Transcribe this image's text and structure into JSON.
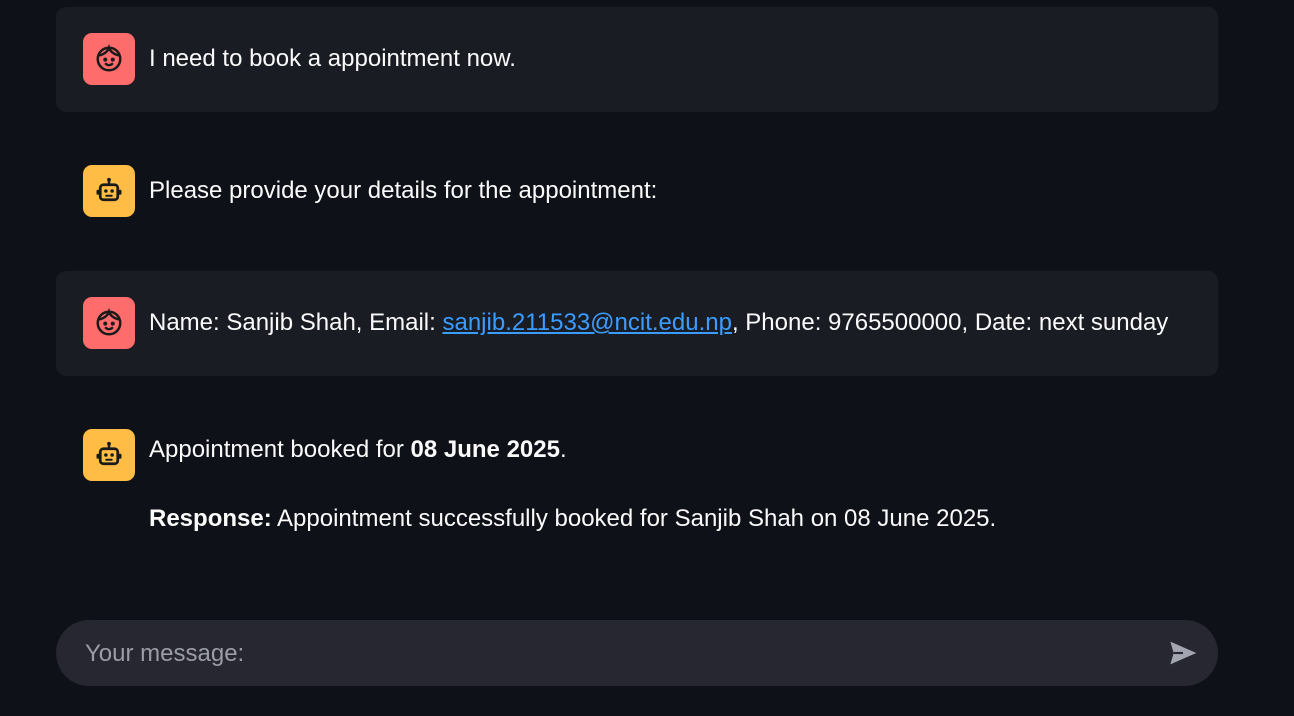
{
  "messages": [
    {
      "role": "user",
      "text": "I need to book a appointment now."
    },
    {
      "role": "assistant",
      "text": "Please provide your details for the appointment:"
    },
    {
      "role": "user",
      "name_prefix": "Name: Sanjib Shah, Email: ",
      "email": "sanjib.211533@ncit.edu.np",
      "suffix": ", Phone: 9765500000, Date: next sunday"
    },
    {
      "role": "assistant",
      "line1_prefix": "Appointment booked for ",
      "line1_bold": "08 June 2025",
      "line1_suffix": ".",
      "line2_bold": "Response:",
      "line2_text": " Appointment successfully booked for Sanjib Shah on 08 June 2025."
    }
  ],
  "input": {
    "placeholder": "Your message:",
    "value": ""
  },
  "icons": {
    "user_avatar": "smile-face-icon",
    "bot_avatar": "robot-icon",
    "send": "send-arrow-icon"
  },
  "colors": {
    "background": "#0e1117",
    "user_bubble": "#1a1c24",
    "user_avatar": "#ff6c6c",
    "bot_avatar": "#ffbd45",
    "link": "#3b9cff",
    "input_bg": "#262730"
  }
}
